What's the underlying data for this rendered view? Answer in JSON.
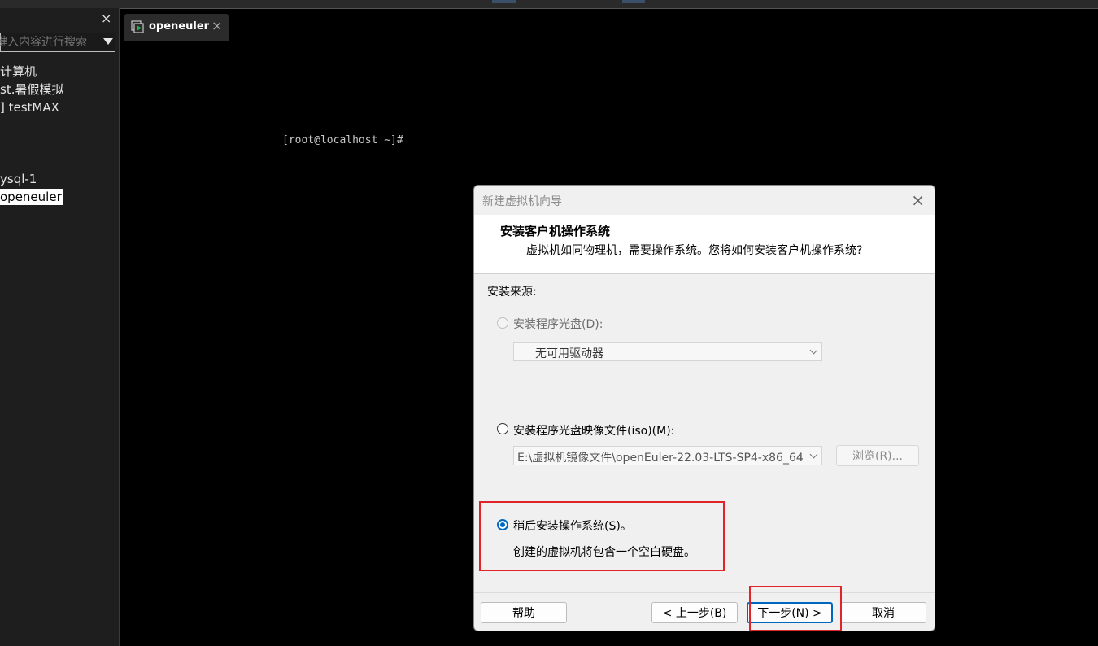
{
  "library": {
    "close_glyph": "×",
    "search_placeholder": "键入内容进行搜索",
    "items": [
      "计算机",
      "st.暑假模拟",
      "] testMAX",
      "ysql-1",
      "openeuler"
    ]
  },
  "tab": {
    "label": "openeuler",
    "close_glyph": "×",
    "icon": "vm-play-icon"
  },
  "console": {
    "prompt": "[root@localhost ~]#"
  },
  "dialog": {
    "title": "新建虚拟机向导",
    "close_glyph": "×",
    "heading": "安装客户机操作系统",
    "subheading": "虚拟机如同物理机，需要操作系统。您将如何安装客户机操作系统?",
    "source_label": "安装来源:",
    "option_disc": {
      "label": "安装程序光盘(D):",
      "enabled": false,
      "selected": false
    },
    "disc_combo": {
      "value": "无可用驱动器"
    },
    "option_iso": {
      "label": "安装程序光盘映像文件(iso)(M):",
      "enabled": true,
      "selected": false
    },
    "iso_combo": {
      "value": "E:\\虚拟机镜像文件\\openEuler-22.03-LTS-SP4-x86_64-"
    },
    "browse_button": "浏览(R)...",
    "option_later": {
      "label": "稍后安装操作系统(S)。",
      "enabled": true,
      "selected": true
    },
    "later_description": "创建的虚拟机将包含一个空白硬盘。",
    "buttons": {
      "help": "帮助",
      "back": "< 上一步(B)",
      "next": "下一步(N) >",
      "cancel": "取消"
    }
  },
  "colors": {
    "accent": "#0067c0",
    "highlight_box": "#e0242a"
  }
}
